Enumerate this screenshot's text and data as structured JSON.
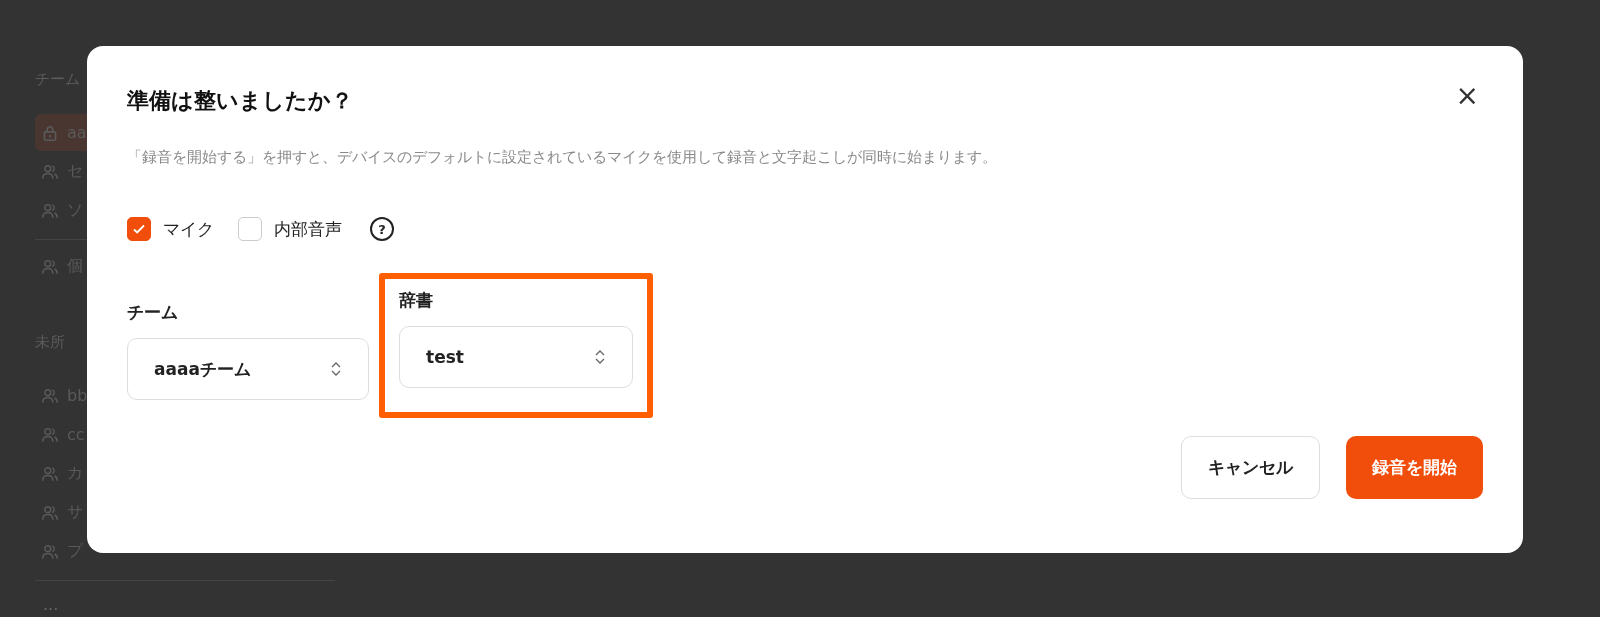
{
  "sidebar": {
    "section_label": "チーム",
    "items": [
      {
        "kind": "private",
        "label": "aa",
        "selected": true
      },
      {
        "kind": "team",
        "label": "セ",
        "selected": false
      },
      {
        "kind": "team",
        "label": "ソ",
        "selected": false
      },
      {
        "kind": "divider"
      },
      {
        "kind": "team",
        "label": "個",
        "selected": false
      },
      {
        "kind": "section",
        "label": "未所"
      },
      {
        "kind": "team",
        "label": "bb",
        "selected": false
      },
      {
        "kind": "team",
        "label": "cc",
        "selected": false
      },
      {
        "kind": "team",
        "label": "カ",
        "selected": false
      },
      {
        "kind": "team",
        "label": "サ",
        "selected": false
      },
      {
        "kind": "team",
        "label": "プ",
        "selected": false
      },
      {
        "kind": "divider"
      },
      {
        "kind": "more",
        "label": "..."
      }
    ]
  },
  "dialog": {
    "title": "準備は整いましたか？",
    "close": "×",
    "description": "「録音を開始する」を押すと、デバイスのデフォルトに設定されているマイクを使用して録音と文字起こしが同時に始まります。",
    "sources": [
      {
        "label": "マイク",
        "checked": true
      },
      {
        "label": "内部音声",
        "checked": false
      }
    ],
    "help": "?",
    "selects": [
      {
        "label": "チーム",
        "value": "aaaaチーム",
        "highlighted": false
      },
      {
        "label": "辞書",
        "value": "test",
        "highlighted": true
      }
    ],
    "buttons": [
      {
        "label": "キャンセル",
        "kind": "secondary"
      },
      {
        "label": "録音を開始",
        "kind": "primary"
      }
    ]
  }
}
